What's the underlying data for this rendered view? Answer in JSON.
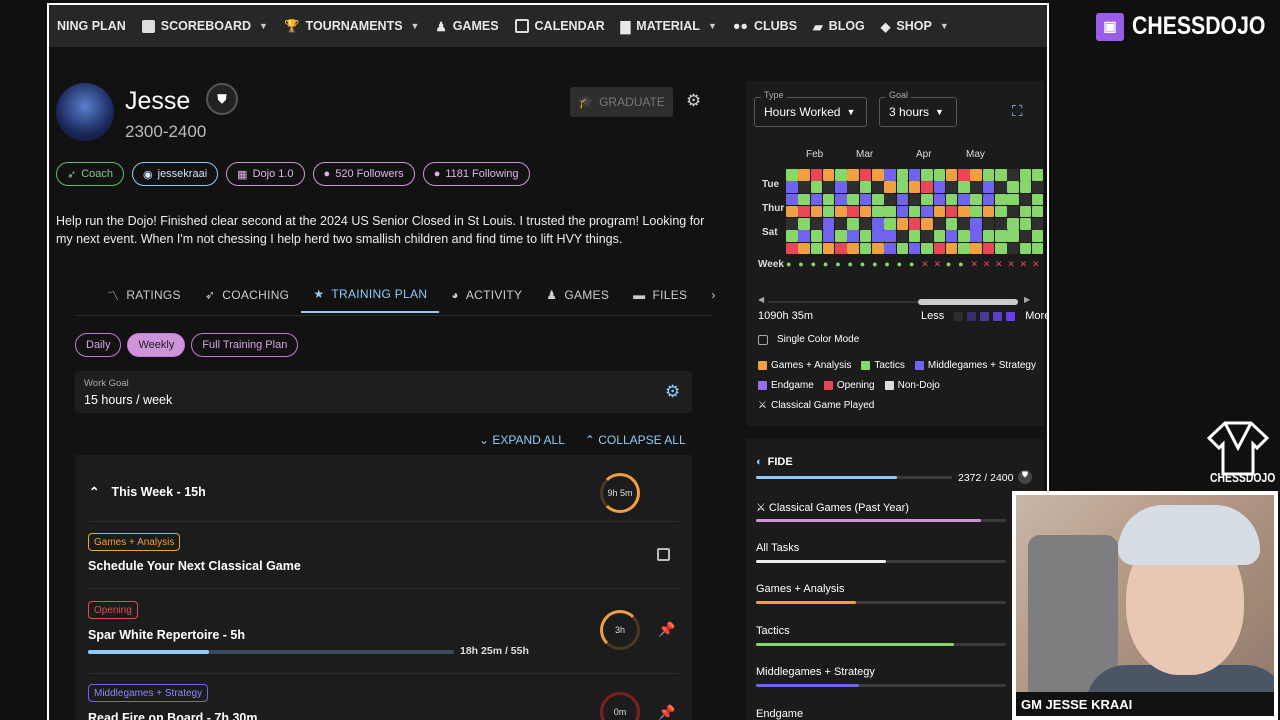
{
  "nav": {
    "items": [
      {
        "label": "NING PLAN"
      },
      {
        "label": "SCOREBOARD",
        "chev": true
      },
      {
        "label": "TOURNAMENTS",
        "chev": true
      },
      {
        "label": "GAMES"
      },
      {
        "label": "CALENDAR"
      },
      {
        "label": "MATERIAL",
        "chev": true
      },
      {
        "label": "CLUBS"
      },
      {
        "label": "BLOG"
      },
      {
        "label": "SHOP",
        "chev": true
      }
    ]
  },
  "profile": {
    "name": "Jesse",
    "rating_range": "2300-2400",
    "graduate_label": "GRADUATE",
    "chips": {
      "coach": "Coach",
      "discord": "jessekraai",
      "dojo": "Dojo 1.0",
      "followers": "520 Followers",
      "following": "1181 Following"
    },
    "bio": "Help run the Dojo! Finished clear second at the 2024 US Senior Closed in St Louis. I trusted the program! Looking for my next event. When I'm not chessing I help herd two smallish children and find time to lift HVY things."
  },
  "tabs": [
    "RATINGS",
    "COACHING",
    "TRAINING PLAN",
    "ACTIVITY",
    "GAMES",
    "FILES"
  ],
  "plan": {
    "pills": [
      "Daily",
      "Weekly",
      "Full Training Plan"
    ],
    "work_goal_label": "Work Goal",
    "work_goal_value": "15 hours / week",
    "expand_all": "EXPAND ALL",
    "collapse_all": "COLLAPSE ALL",
    "week_title": "This Week - 15h",
    "week_ring": "9h 5m",
    "tasks": [
      {
        "tag": "Games + Analysis",
        "title": "Schedule Your Next Classical Game"
      },
      {
        "tag": "Opening",
        "title": "Spar White Repertoire - 5h",
        "ring": "3h",
        "progress": "18h 25m / 55h",
        "fraction": 0.33
      },
      {
        "tag": "Middlegames + Strategy",
        "title": "Read Fire on Board - 7h 30m",
        "ring": "0m"
      }
    ]
  },
  "heatmap": {
    "type_label": "Type",
    "type_value": "Hours Worked",
    "goal_label": "Goal",
    "goal_value": "3 hours",
    "months": [
      "Feb",
      "Mar",
      "Apr",
      "May"
    ],
    "days": [
      "Tue",
      "Thur",
      "Sat"
    ],
    "week_label": "Week",
    "total": "1090h 35m",
    "less": "Less",
    "more": "More",
    "single_color_mode": "Single Color Mode",
    "legend": [
      "Games + Analysis",
      "Tactics",
      "Middlegames + Strategy",
      "Endgame",
      "Opening",
      "Non-Dojo"
    ],
    "classical_played": "Classical Game Played",
    "colors": {
      "games": "#f0a040",
      "tactics": "#86d66b",
      "middle": "#6f63f0",
      "endgame": "#9b6cf0",
      "opening": "#e84855",
      "nondojo": "#dddddd",
      "empty": "#2e2e2e"
    }
  },
  "fide": {
    "label": "FIDE",
    "value": "2372 / 2400",
    "rows": [
      {
        "label": "Classical Games (Past Year)",
        "fraction": 0.9
      },
      {
        "label": "All Tasks",
        "fraction": 0.52
      },
      {
        "label": "Games + Analysis",
        "fraction": 0.4
      },
      {
        "label": "Tactics",
        "fraction": 0.79
      },
      {
        "label": "Middlegames + Strategy",
        "fraction": 0.41
      },
      {
        "label": "Endgame"
      }
    ]
  },
  "overlay": {
    "brand": "CHESSDOJO",
    "logo_label": "CHESSDOJO",
    "camera_label": "GM JESSE KRAAI"
  }
}
